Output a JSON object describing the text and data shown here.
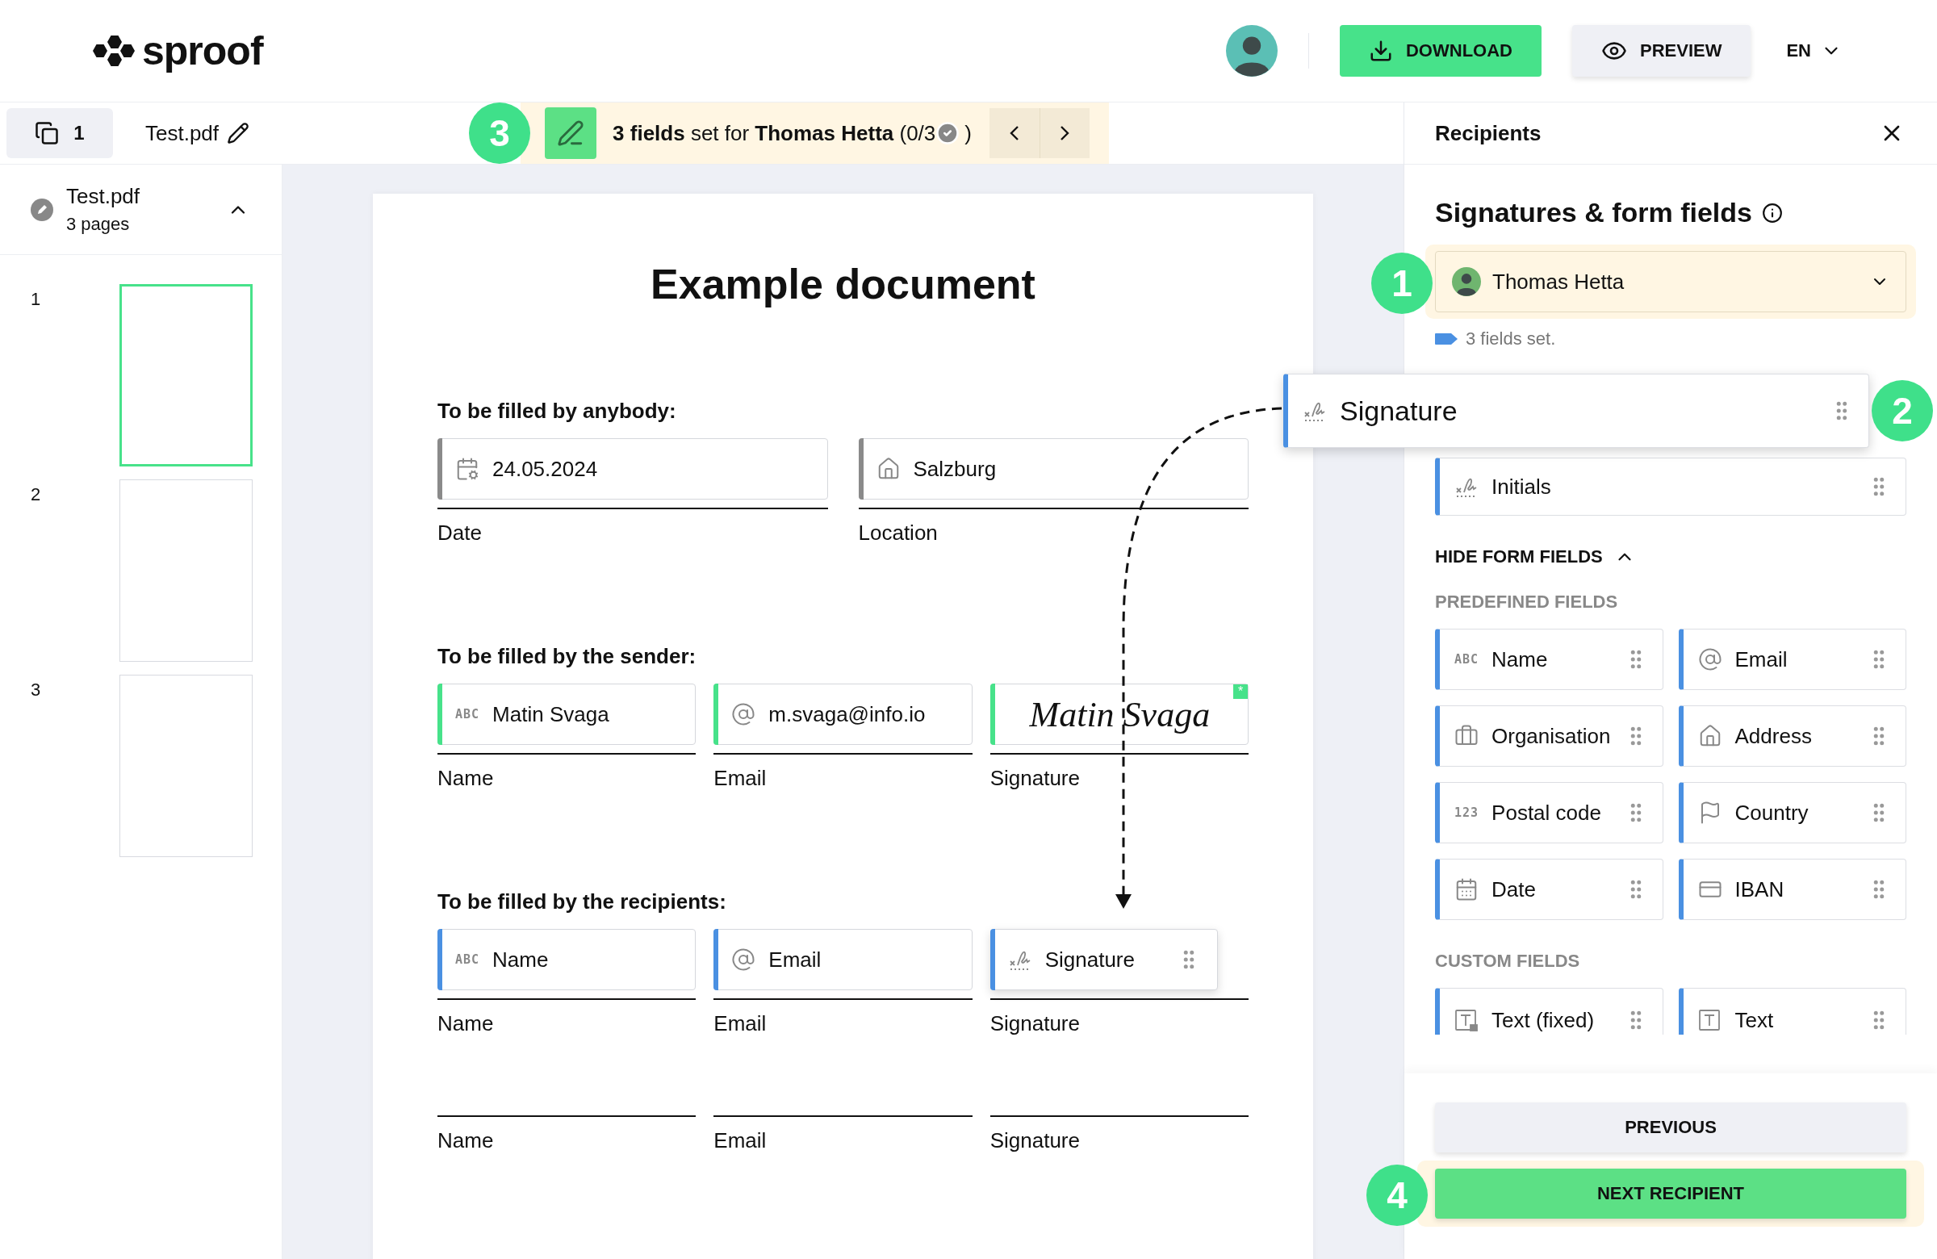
{
  "header": {
    "logo": "sproof",
    "download": "DOWNLOAD",
    "preview": "PREVIEW",
    "language": "EN"
  },
  "toolbar": {
    "page_count": "1",
    "filename": "Test.pdf",
    "step": "3",
    "status": "**3 fields** set for **Thomas Hetta** (0/3",
    "status_end": ")"
  },
  "sidebar": {
    "document": {
      "name": "Test.pdf",
      "pages": "3 pages",
      "expanded": true
    },
    "thumbnails": [
      {
        "number": "1",
        "selected": true
      },
      {
        "number": "2",
        "selected": false
      },
      {
        "number": "3",
        "selected": false
      }
    ]
  },
  "document": {
    "title": "Example document",
    "sections": [
      {
        "heading": "To be filled by anybody:",
        "rows": [
          {
            "cells": [
              {
                "label": "Date",
                "field": {
                  "kind": "date",
                  "value": "24.05.2024",
                  "color": "#8a8a8a"
                }
              },
              {
                "label": "Location",
                "field": {
                  "kind": "address",
                  "value": "Salzburg",
                  "color": "#8a8a8a"
                }
              }
            ]
          }
        ]
      },
      {
        "heading": "To be filled by the sender:",
        "rows": [
          {
            "cells": [
              {
                "label": "Name",
                "field": {
                  "kind": "name",
                  "type_label": "ABC",
                  "value": "Matin Svaga",
                  "color": "#47e28a"
                }
              },
              {
                "label": "Email",
                "field": {
                  "kind": "email",
                  "value": "m.svaga@info.io",
                  "color": "#47e28a"
                }
              },
              {
                "label": "Signature",
                "field": {
                  "kind": "signature_image",
                  "value": "Matin Svaga",
                  "color": "#47e28a",
                  "required_mark": "*"
                }
              }
            ]
          }
        ]
      },
      {
        "heading": "To be filled by the recipients:",
        "rows": [
          {
            "cells": [
              {
                "label": "Name",
                "field": {
                  "kind": "name",
                  "type_label": "ABC",
                  "value": "Name",
                  "color": "#4a90e2"
                }
              },
              {
                "label": "Email",
                "field": {
                  "kind": "email",
                  "value": "Email",
                  "color": "#4a90e2"
                }
              },
              {
                "label": "Signature",
                "field": {
                  "kind": "signature",
                  "value": "Signature",
                  "color": "#4a90e2",
                  "handle": true
                }
              }
            ]
          },
          {
            "cells": [
              {
                "label": "Name"
              },
              {
                "label": "Email"
              },
              {
                "label": "Signature"
              }
            ]
          }
        ]
      }
    ]
  },
  "panel": {
    "title": "Recipients",
    "heading": "Signatures & form fields",
    "recipient": {
      "name": "Thomas Hetta",
      "step": "1"
    },
    "fields_set": "3 fields set.",
    "signature_fields": [
      {
        "kind": "signature",
        "label": "Signature",
        "dragging": true,
        "step": "2"
      },
      {
        "kind": "signature",
        "label": "Initials",
        "dragging": false
      }
    ],
    "toggle": {
      "label": "HIDE FORM FIELDS",
      "expanded": true
    },
    "groups": [
      {
        "title": "PREDEFINED FIELDS",
        "fields": [
          {
            "kind": "name",
            "type_label": "ABC",
            "label": "Name"
          },
          {
            "kind": "email",
            "label": "Email"
          },
          {
            "kind": "organisation",
            "label": "Organisation"
          },
          {
            "kind": "address",
            "label": "Address"
          },
          {
            "kind": "postal_code",
            "type_label": "123",
            "label": "Postal code"
          },
          {
            "kind": "country",
            "label": "Country"
          },
          {
            "kind": "calendar",
            "label": "Date"
          },
          {
            "kind": "iban",
            "label": "IBAN"
          }
        ]
      },
      {
        "title": "CUSTOM FIELDS",
        "fields": [
          {
            "kind": "text_fixed",
            "label": "Text (fixed)"
          },
          {
            "kind": "text",
            "label": "Text"
          }
        ]
      }
    ],
    "previous": "PREVIOUS",
    "next": {
      "label": "NEXT RECIPIENT",
      "step": "4"
    }
  }
}
